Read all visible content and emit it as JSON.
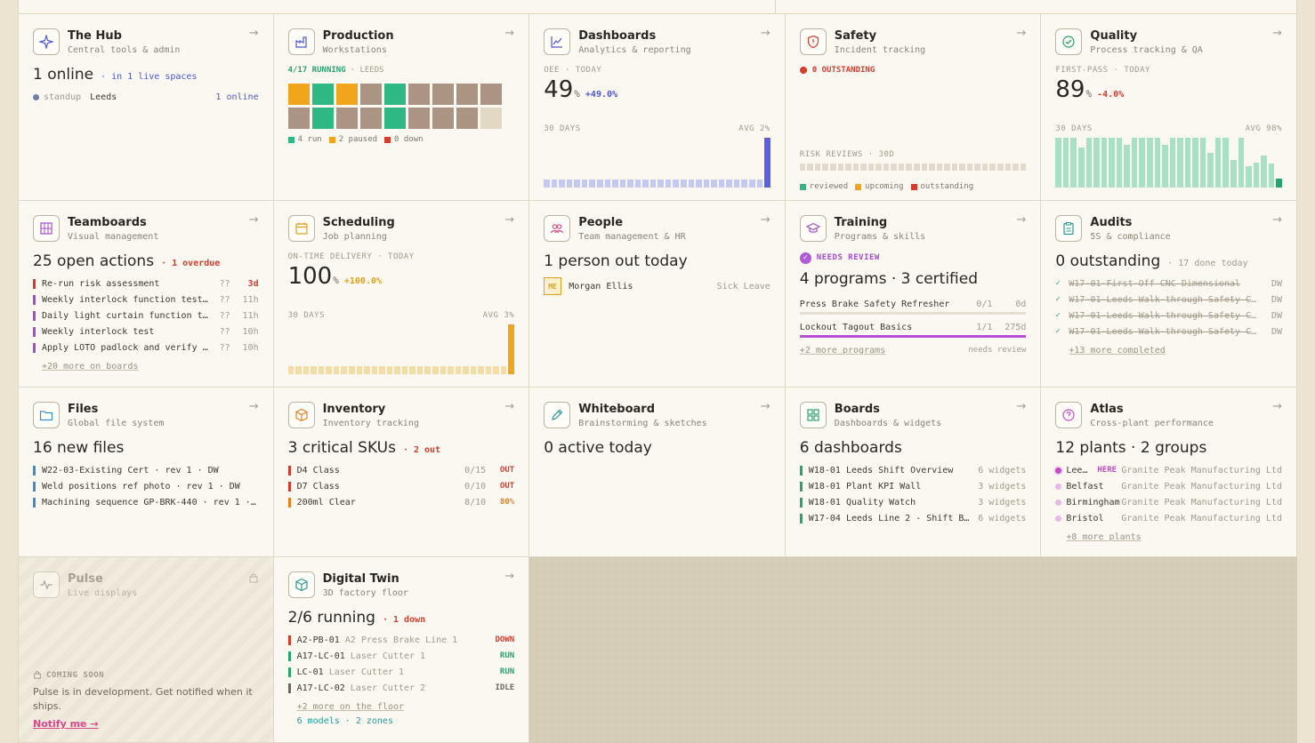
{
  "cards": {
    "hub": {
      "title": "The Hub",
      "subtitle": "Central tools & admin",
      "online": "1 online",
      "live": "· in 1 live spaces",
      "tag": "standup",
      "place": "Leeds",
      "count": "1 online"
    },
    "production": {
      "title": "Production",
      "subtitle": "Workstations",
      "running": "4/17 RUNNING",
      "site": "· LEEDS",
      "tiles": [
        "orange",
        "green",
        "orange",
        "brown",
        "green",
        "brown",
        "brown",
        "brown",
        "brown",
        "brown",
        "green",
        "brown",
        "brown",
        "green",
        "brown",
        "brown",
        "brown",
        "idle"
      ],
      "legend": [
        {
          "color": "#2fb784",
          "label": "4 run"
        },
        {
          "color": "#f0a51c",
          "label": "2 paused"
        },
        {
          "color": "#d63c2c",
          "label": "0 down"
        }
      ]
    },
    "dashboards": {
      "title": "Dashboards",
      "subtitle": "Analytics & reporting",
      "label": "OEE · TODAY",
      "value": "49",
      "unit": "%",
      "delta": "+49.0%",
      "period": "30 DAYS",
      "avg": "AVG 2%",
      "spark": [
        0.16,
        0.16,
        0.16,
        0.16,
        0.16,
        0.16,
        0.16,
        0.16,
        0.16,
        0.16,
        0.16,
        0.16,
        0.16,
        0.16,
        0.16,
        0.16,
        0.16,
        0.16,
        0.16,
        0.16,
        0.16,
        0.16,
        0.16,
        0.16,
        0.16,
        0.16,
        0.16,
        0.16,
        0.16,
        1.0
      ]
    },
    "safety": {
      "title": "Safety",
      "subtitle": "Incident tracking",
      "outstanding": "0 OUTSTANDING",
      "reviews": "RISK REVIEWS · 30D",
      "legend": [
        {
          "color": "#2fb784",
          "label": "reviewed"
        },
        {
          "color": "#f0a51c",
          "label": "upcoming"
        },
        {
          "color": "#d63c2c",
          "label": "outstanding"
        }
      ]
    },
    "quality": {
      "title": "Quality",
      "subtitle": "Process tracking & QA",
      "label": "FIRST-PASS · TODAY",
      "value": "89",
      "unit": "%",
      "delta": "-4.0%",
      "period": "30 DAYS",
      "avg": "AVG 98%",
      "spark": [
        1.0,
        1.0,
        1.0,
        0.8,
        1.0,
        1.0,
        1.0,
        1.0,
        1.0,
        0.85,
        1.0,
        1.0,
        1.0,
        1.0,
        0.85,
        1.0,
        1.0,
        1.0,
        1.0,
        1.0,
        0.7,
        1.0,
        1.0,
        0.55,
        1.0,
        0.42,
        0.5,
        0.64,
        0.48,
        0.18
      ]
    },
    "teamboards": {
      "title": "Teamboards",
      "subtitle": "Visual management",
      "open": "25 open actions",
      "overdue": "· 1 overdue",
      "items": [
        {
          "text": "Re-run risk assessment",
          "q": "??",
          "due": "3d",
          "color": "#d63c2c",
          "dueColor": "#d63c2c"
        },
        {
          "text": "Weekly interlock function test…",
          "q": "??",
          "due": "11h",
          "color": "#a44bd0",
          "dueColor": "#a29a8c"
        },
        {
          "text": "Daily light curtain function t…",
          "q": "??",
          "due": "11h",
          "color": "#a44bd0",
          "dueColor": "#a29a8c"
        },
        {
          "text": "Weekly interlock test",
          "q": "??",
          "due": "10h",
          "color": "#a44bd0",
          "dueColor": "#a29a8c"
        },
        {
          "text": "Apply LOTO padlock and verify …",
          "q": "??",
          "due": "10h",
          "color": "#a44bd0",
          "dueColor": "#a29a8c"
        }
      ],
      "more": "+20 more on boards"
    },
    "scheduling": {
      "title": "Scheduling",
      "subtitle": "Job planning",
      "label": "ON-TIME DELIVERY · TODAY",
      "value": "100",
      "unit": "%",
      "delta": "+100.0%",
      "period": "30 DAYS",
      "avg": "AVG 3%",
      "spark": [
        0.16,
        0.16,
        0.16,
        0.16,
        0.16,
        0.16,
        0.16,
        0.16,
        0.16,
        0.16,
        0.16,
        0.16,
        0.16,
        0.16,
        0.16,
        0.16,
        0.16,
        0.16,
        0.16,
        0.16,
        0.16,
        0.16,
        0.16,
        0.16,
        0.16,
        0.16,
        0.16,
        0.16,
        0.16,
        1.0
      ]
    },
    "people": {
      "title": "People",
      "subtitle": "Team management & HR",
      "out": "1 person out today",
      "initials": "ME",
      "name": "Morgan Ellis",
      "reason": "Sick Leave"
    },
    "training": {
      "title": "Training",
      "subtitle": "Programs & skills",
      "badge": "NEEDS REVIEW",
      "summary": "4 programs · 3 certified",
      "programs": [
        {
          "name": "Press Brake Safety Refresher",
          "ratio": "0/1",
          "days": "0d",
          "progress": 0.0
        },
        {
          "name": "Lockout Tagout Basics",
          "ratio": "1/1",
          "days": "275d",
          "progress": 1.0
        }
      ],
      "more": "+2 more programs",
      "status": "needs review"
    },
    "audits": {
      "title": "Audits",
      "subtitle": "5S & compliance",
      "outstanding": "0 outstanding",
      "done": "· 17 done today",
      "items": [
        {
          "text": "W17-01-First-Off CNC Dimensional",
          "who": "DW"
        },
        {
          "text": "W17-01-Leeds Walk-through Safety Ch…",
          "who": "DW"
        },
        {
          "text": "W17-01-Leeds Walk-through Safety Ch…",
          "who": "DW"
        },
        {
          "text": "W17-01-Leeds Walk-through Safety Ch…",
          "who": "DW"
        }
      ],
      "more": "+13 more completed"
    },
    "files": {
      "title": "Files",
      "subtitle": "Global file system",
      "count": "16 new files",
      "items": [
        "W22-03-Existing Cert · rev 1 · DW",
        "Weld positions ref photo · rev 1 · DW",
        "Machining sequence GP-BRK-440 · rev 1 ·…"
      ]
    },
    "inventory": {
      "title": "Inventory",
      "subtitle": "Inventory tracking",
      "critical": "3 critical SKUs",
      "out": "· 2 out",
      "items": [
        {
          "name": "D4 Class",
          "qty": "0/15",
          "status": "OUT",
          "color": "#d63c2c"
        },
        {
          "name": "D7 Class",
          "qty": "0/10",
          "status": "OUT",
          "color": "#d63c2c"
        },
        {
          "name": "200ml Clear",
          "qty": "8/10",
          "status": "80%",
          "color": "#e77f1e"
        }
      ]
    },
    "whiteboard": {
      "title": "Whiteboard",
      "subtitle": "Brainstorming & sketches",
      "active": "0 active today"
    },
    "boards": {
      "title": "Boards",
      "subtitle": "Dashboards & widgets",
      "count": "6 dashboards",
      "items": [
        {
          "name": "W18-01 Leeds Shift Overview",
          "widgets": "6 widgets"
        },
        {
          "name": "W18-01 Plant KPI Wall",
          "widgets": "3 widgets"
        },
        {
          "name": "W18-01 Quality Watch",
          "widgets": "3 widgets"
        },
        {
          "name": "W17-04 Leeds Line 2 - Shift B…",
          "widgets": "6 widgets"
        }
      ]
    },
    "atlas": {
      "title": "Atlas",
      "subtitle": "Cross-plant performance",
      "summary": "12 plants · 2 groups",
      "here": "HERE",
      "items": [
        {
          "name": "Lee…",
          "org": "Granite Peak Manufacturing Ltd"
        },
        {
          "name": "Belfast",
          "org": "Granite Peak Manufacturing Ltd"
        },
        {
          "name": "Birmingham",
          "org": "Granite Peak Manufacturing Ltd"
        },
        {
          "name": "Bristol",
          "org": "Granite Peak Manufacturing Ltd"
        }
      ],
      "more": "+8 more plants"
    },
    "pulse": {
      "title": "Pulse",
      "subtitle": "Live displays",
      "soon": "COMING SOON",
      "desc": "Pulse is in development. Get notified when it ships.",
      "notify": "Notify me →"
    },
    "twin": {
      "title": "Digital Twin",
      "subtitle": "3D factory floor",
      "running": "2/6 running",
      "down": "· 1 down",
      "items": [
        {
          "code": "A2-PB-01",
          "name": "A2 Press Brake Line 1",
          "status": "DOWN",
          "color": "#d63c2c"
        },
        {
          "code": "A17-LC-01",
          "name": "Laser Cutter 1",
          "status": "RUN",
          "color": "#27a36f"
        },
        {
          "code": "LC-01",
          "name": "Laser Cutter 1",
          "status": "RUN",
          "color": "#27a36f"
        },
        {
          "code": "A17-LC-02",
          "name": "Laser Cutter 2",
          "status": "IDLE",
          "color": "#6e675c"
        }
      ],
      "more": "+2 more on the floor",
      "footer": "6 models · 2 zones"
    }
  },
  "arrow": "→"
}
